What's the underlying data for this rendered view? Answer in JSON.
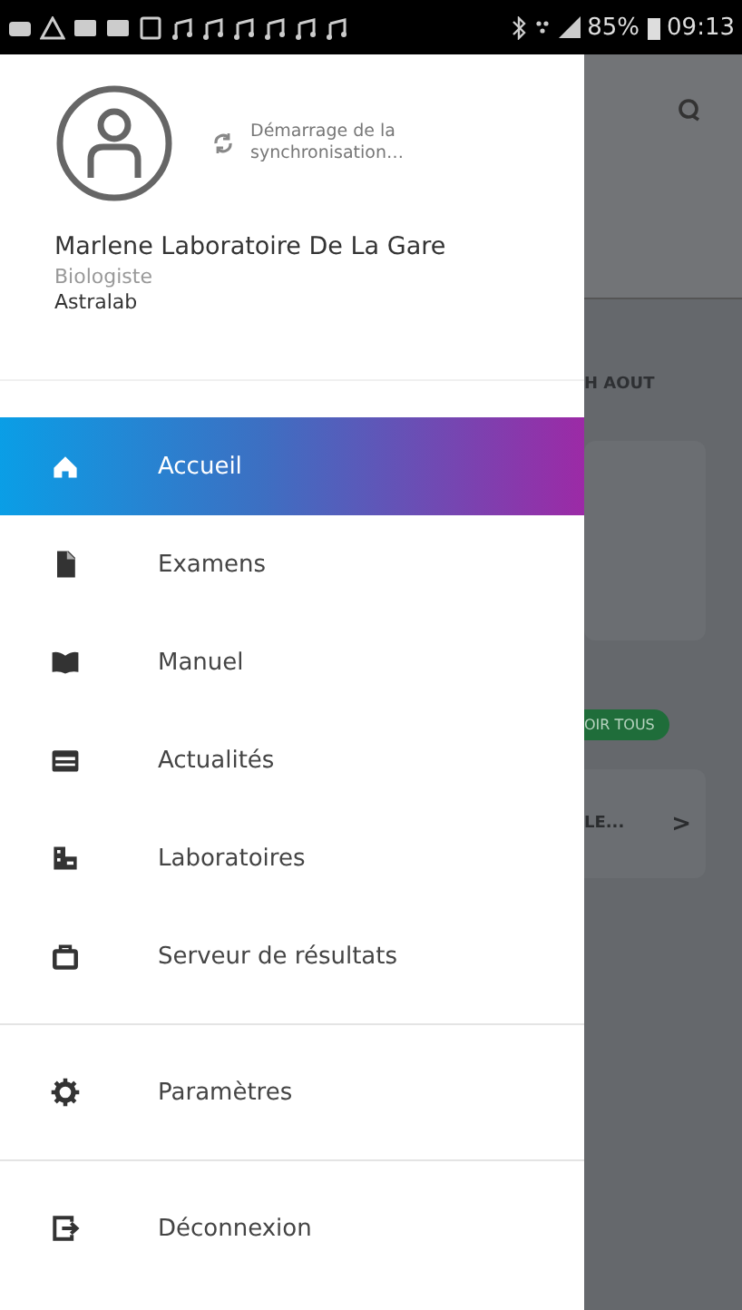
{
  "status_bar": {
    "battery": "85%",
    "time": "09:13"
  },
  "drawer": {
    "sync_status": "Démarrage de la synchronisation…",
    "user_name": "Marlene Laboratoire De La Gare",
    "role": "Biologiste",
    "organization": "Astralab",
    "menu_groups": [
      [
        {
          "label": "Accueil",
          "selected": true
        },
        {
          "label": "Examens",
          "selected": false
        },
        {
          "label": "Manuel",
          "selected": false
        },
        {
          "label": "Actualités",
          "selected": false
        },
        {
          "label": "Laboratoires",
          "selected": false
        },
        {
          "label": "Serveur de résultats",
          "selected": false
        }
      ],
      [
        {
          "label": "Paramètres",
          "selected": false
        }
      ],
      [
        {
          "label": "Déconnexion",
          "selected": false
        }
      ]
    ]
  },
  "background": {
    "date_heading": "H AOUT",
    "see_all_button": "OIR TOUS",
    "card_title": "LE...",
    "card_chevron": ">"
  }
}
